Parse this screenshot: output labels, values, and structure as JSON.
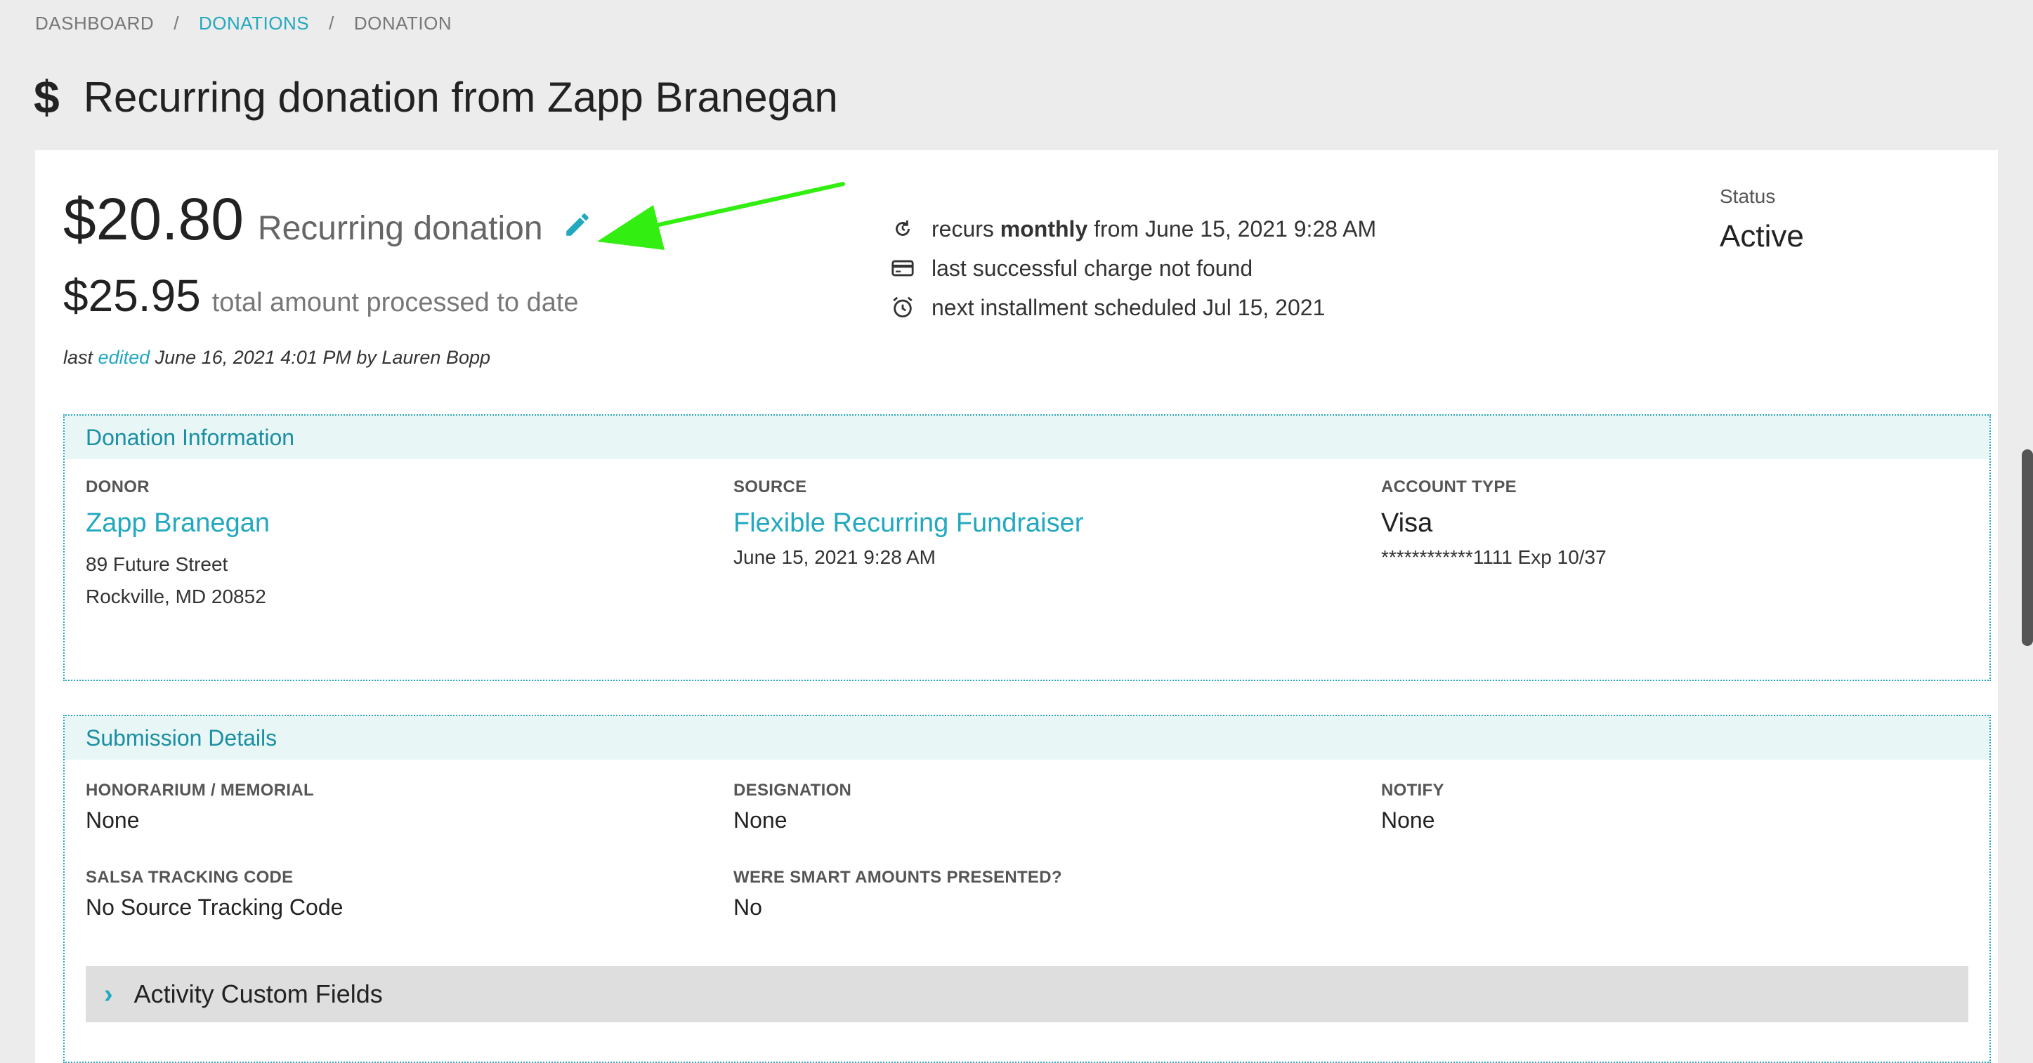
{
  "breadcrumb": {
    "dashboard": "DASHBOARD",
    "donations": "DONATIONS",
    "donation": "DONATION",
    "separator": "/"
  },
  "page": {
    "title_icon": "$",
    "title": "Recurring donation from Zapp Branegan"
  },
  "summary": {
    "amount": "$20.80",
    "amount_label": "Recurring donation",
    "total_amount": "$25.95",
    "total_label": "total amount processed to date",
    "edited_prefix": "last",
    "edited_link": "edited",
    "edited_suffix": "June 16, 2021 4:01 PM by Lauren Bopp"
  },
  "schedule": {
    "recurs_prefix": "recurs",
    "recurs_frequency": "monthly",
    "recurs_suffix": "from June 15, 2021 9:28 AM",
    "last_charge": "last successful charge not found",
    "next_installment": "next installment scheduled Jul 15, 2021"
  },
  "status": {
    "label": "Status",
    "value": "Active"
  },
  "donation_info": {
    "header": "Donation Information",
    "donor_label": "DONOR",
    "donor_name": "Zapp Branegan",
    "donor_address_1": "89 Future Street",
    "donor_address_2": "Rockville, MD 20852",
    "source_label": "SOURCE",
    "source_name": "Flexible Recurring Fundraiser",
    "source_date": "June 15, 2021 9:28 AM",
    "account_type_label": "ACCOUNT TYPE",
    "account_type": "Visa",
    "account_number": "************1111 Exp 10/37"
  },
  "submission": {
    "header": "Submission Details",
    "honorarium_label": "HONORARIUM / MEMORIAL",
    "honorarium_value": "None",
    "designation_label": "DESIGNATION",
    "designation_value": "None",
    "notify_label": "NOTIFY",
    "notify_value": "None",
    "tracking_label": "SALSA TRACKING CODE",
    "tracking_value": "No Source Tracking Code",
    "smart_label": "WERE SMART AMOUNTS PRESENTED?",
    "smart_value": "No",
    "custom_fields_label": "Activity Custom Fields"
  },
  "icons": {
    "title": "dollar-icon",
    "edit": "pencil-icon",
    "recurs": "refresh-icon",
    "charge": "credit-card-icon",
    "next": "alarm-clock-icon",
    "expand": "chevron-right-icon",
    "annotation": "green-arrow-icon"
  },
  "colors": {
    "accent": "#22a8bf",
    "panel_header_bg": "#e8f6f5",
    "annotation_arrow": "#33ee11",
    "page_bg": "#ececec"
  }
}
